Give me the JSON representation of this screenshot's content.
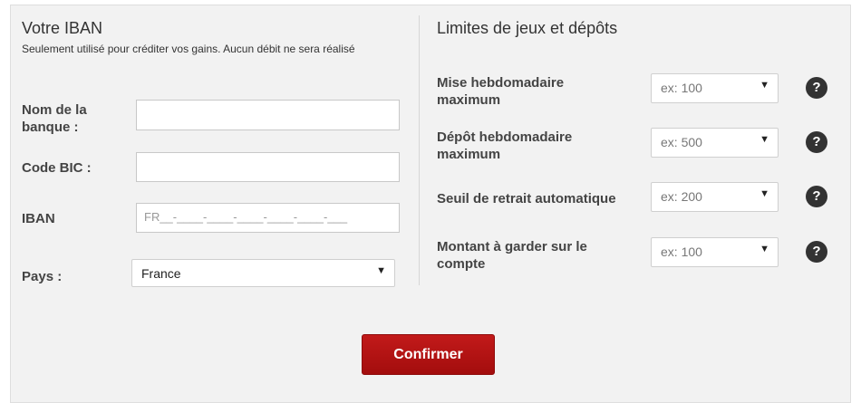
{
  "iban_section": {
    "title": "Votre IBAN",
    "subtitle": "Seulement utilisé pour créditer vos gains. Aucun débit ne sera réalisé",
    "bank_name_label": "Nom de la banque :",
    "bank_name_value": "",
    "bic_label": "Code BIC :",
    "bic_value": "",
    "iban_label": "IBAN",
    "iban_mask": "FR__-____-____-____-____-____-___",
    "country_label": "Pays :",
    "country_value": "France"
  },
  "limits_section": {
    "title": "Limites de jeux et dépôts",
    "rows": [
      {
        "label": "Mise hebdomadaire maximum",
        "placeholder": "ex: 100"
      },
      {
        "label": "Dépôt hebdomadaire maximum",
        "placeholder": "ex: 500"
      },
      {
        "label": "Seuil de retrait automatique",
        "placeholder": "ex: 200"
      },
      {
        "label": "Montant à garder sur le compte",
        "placeholder": "ex: 100"
      }
    ],
    "help_glyph": "?",
    "caret_glyph": "▼"
  },
  "confirm_label": "Confirmer",
  "colors": {
    "button": "#b01212",
    "panel": "#f2f2f2",
    "help": "#333333"
  }
}
